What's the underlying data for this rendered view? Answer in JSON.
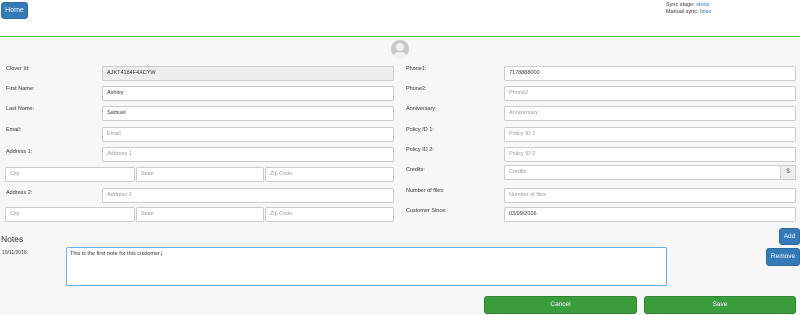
{
  "header": {
    "home_label": "Home",
    "sync_stage_label": "Sync stage:",
    "sync_stage_value": "sleep",
    "manual_sync_label": "Manual sync:",
    "manual_sync_value": "false"
  },
  "form": {
    "clover_id": {
      "label": "Clover Id:",
      "value": "AJKT4184F4XCYW"
    },
    "first_name": {
      "label": "First Name:",
      "value": "Ashley"
    },
    "last_name": {
      "label": "Last Name:",
      "value": "Samuel"
    },
    "email": {
      "label": "Email:",
      "placeholder": "Email"
    },
    "address1": {
      "label": "Address 1:",
      "placeholder": "Address 1"
    },
    "city1": {
      "placeholder": "City"
    },
    "state1": {
      "placeholder": "State"
    },
    "zip1": {
      "placeholder": "Zip Code"
    },
    "address2": {
      "label": "Address 2:",
      "placeholder": "Address 2"
    },
    "city2": {
      "placeholder": "City"
    },
    "state2": {
      "placeholder": "State"
    },
    "zip2": {
      "placeholder": "Zip Code"
    },
    "phone1": {
      "label": "Phone1:",
      "value": "7178888000"
    },
    "phone2": {
      "label": "Phone2:",
      "placeholder": "Phone2"
    },
    "anniversary": {
      "label": "Anniversary:",
      "placeholder": "Anniversary"
    },
    "policy1": {
      "label": "Policy ID 1:",
      "placeholder": "Policy ID 1"
    },
    "policy2": {
      "label": "Policy ID 2:",
      "placeholder": "Policy ID 2"
    },
    "credits": {
      "label": "Credits:",
      "placeholder": "Credits",
      "addon": "$"
    },
    "num_files": {
      "label": "Number of files:",
      "placeholder": "Number of files"
    },
    "customer_since": {
      "label": "Customer Since:",
      "value": "03/09/2016"
    }
  },
  "notes": {
    "title": "Notes",
    "date": "10/11/2016:",
    "text": "This is the first note for this customer.|",
    "add_label": "Add",
    "remove_label": "Remove"
  },
  "footer": {
    "cancel_label": "Cancel",
    "save_label": "Save"
  },
  "colors": {
    "primary": "#337ab7",
    "success": "#3a9c3a",
    "divider": "#5cb85c"
  }
}
